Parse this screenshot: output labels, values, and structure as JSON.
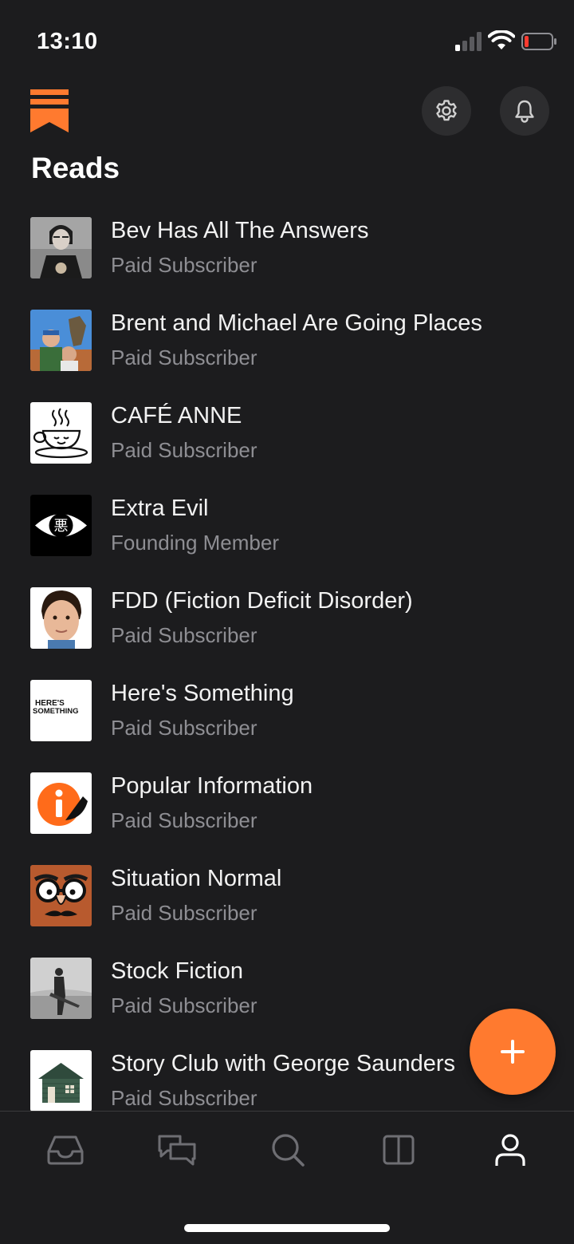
{
  "status_bar": {
    "time": "13:10",
    "icons": [
      "cellular-signal-icon",
      "wifi-icon",
      "battery-low-icon"
    ]
  },
  "header": {
    "logo": "substack-bookmark-logo",
    "title": "Reads",
    "buttons": [
      "settings-icon",
      "notifications-bell-icon"
    ]
  },
  "colors": {
    "background": "#1c1c1e",
    "accent": "#ff7a2f",
    "secondary_text": "#8e8e93",
    "battery_low": "#ff3b30"
  },
  "publications": [
    {
      "name": "Bev Has All The Answers",
      "status": "Paid Subscriber",
      "thumb": "bev-portrait"
    },
    {
      "name": "Brent and Michael Are Going Places",
      "status": "Paid Subscriber",
      "thumb": "brent-michael-photo"
    },
    {
      "name": "CAFÉ ANNE",
      "status": "Paid Subscriber",
      "thumb": "coffee-cup"
    },
    {
      "name": "Extra Evil",
      "status": "Founding Member",
      "thumb": "evil-eye"
    },
    {
      "name": "FDD (Fiction Deficit Disorder)",
      "status": "Paid Subscriber",
      "thumb": "child-portrait"
    },
    {
      "name": "Here's Something",
      "status": "Paid Subscriber",
      "thumb": "heres-something-text"
    },
    {
      "name": "Popular Information",
      "status": "Paid Subscriber",
      "thumb": "info-logo"
    },
    {
      "name": "Situation Normal",
      "status": "Paid Subscriber",
      "thumb": "disguise-face"
    },
    {
      "name": "Stock Fiction",
      "status": "Paid Subscriber",
      "thumb": "guitarist-photo"
    },
    {
      "name": "Story Club with George Saunders",
      "status": "Paid Subscriber",
      "thumb": "green-house"
    }
  ],
  "thumb_text": {
    "heres_something_line1": "HERE'S",
    "heres_something_line2": "SOMETHING",
    "evil_glyph": "悪"
  },
  "fab": {
    "icon": "plus-icon"
  },
  "tab_bar": {
    "tabs": [
      {
        "icon": "inbox-icon"
      },
      {
        "icon": "chat-icon"
      },
      {
        "icon": "search-icon"
      },
      {
        "icon": "reader-icon"
      },
      {
        "icon": "profile-icon",
        "active": true
      }
    ]
  }
}
